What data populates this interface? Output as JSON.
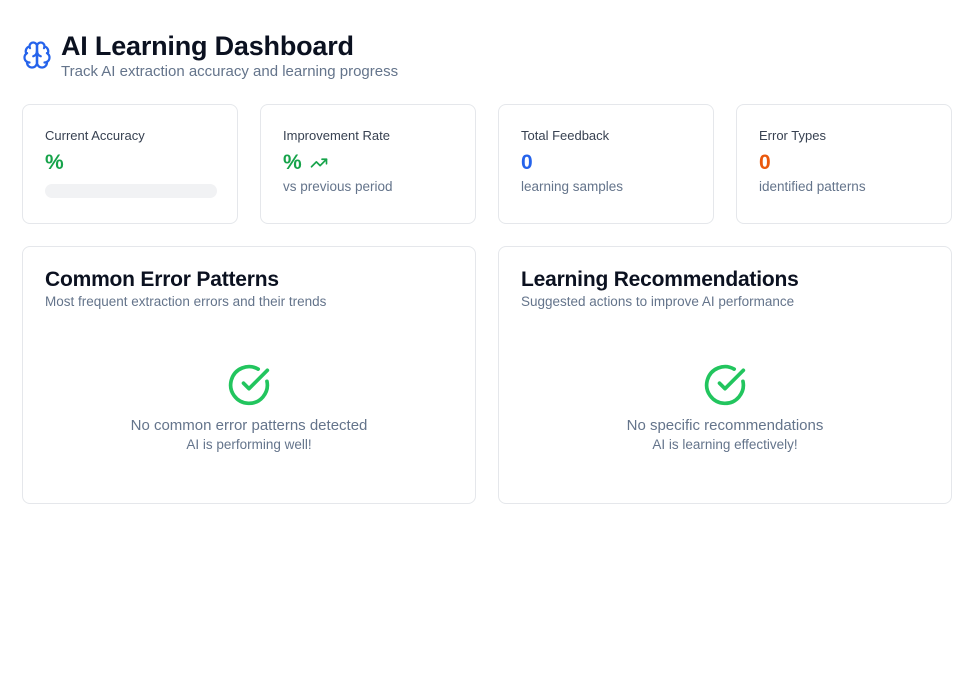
{
  "header": {
    "title": "AI Learning Dashboard",
    "subtitle": "Track AI extraction accuracy and learning progress",
    "icon": "brain-icon",
    "icon_color": "#2563eb"
  },
  "stats": [
    {
      "label": "Current Accuracy",
      "value": "%",
      "progress_percent": 0,
      "color": "#16a34a"
    },
    {
      "label": "Improvement Rate",
      "value": "%",
      "caption": "vs previous period",
      "icon": "trending-up-icon",
      "color": "#16a34a"
    },
    {
      "label": "Total Feedback",
      "value": "0",
      "caption": "learning samples",
      "color": "#2563eb"
    },
    {
      "label": "Error Types",
      "value": "0",
      "caption": "identified patterns",
      "color": "#ea580c"
    }
  ],
  "panels": {
    "errors": {
      "title": "Common Error Patterns",
      "subtitle": "Most frequent extraction errors and their trends",
      "empty_icon": "check-circle-icon",
      "empty_title": "No common error patterns detected",
      "empty_sub": "AI is performing well!"
    },
    "recommendations": {
      "title": "Learning Recommendations",
      "subtitle": "Suggested actions to improve AI performance",
      "empty_icon": "check-circle-icon",
      "empty_title": "No specific recommendations",
      "empty_sub": "AI is learning effectively!"
    }
  },
  "colors": {
    "success": "#22c55e",
    "accent": "#2563eb",
    "warning": "#ea580c",
    "border": "#e5e7eb"
  }
}
